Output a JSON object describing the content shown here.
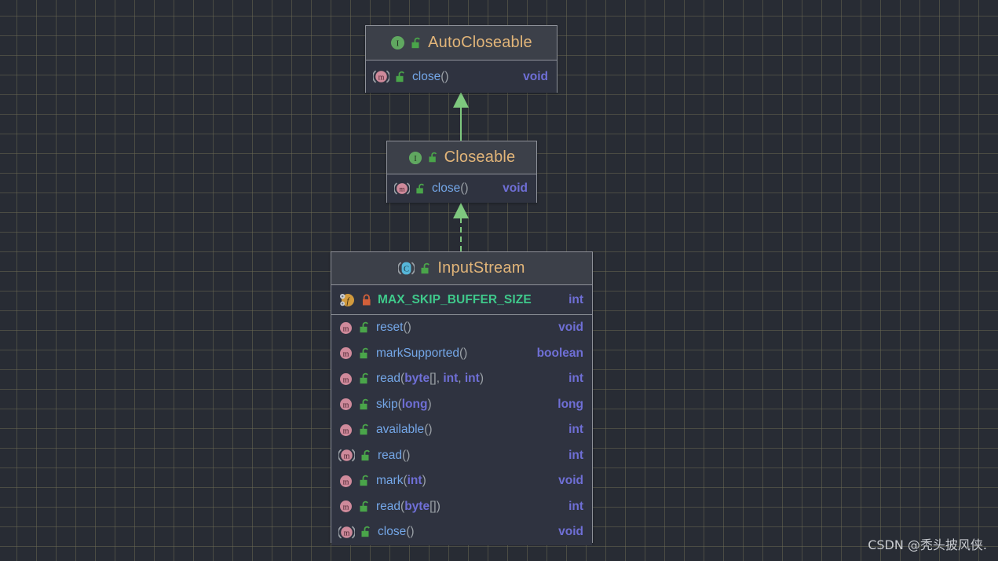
{
  "diagram": {
    "type": "uml-class-diagram",
    "background_color": "#282c34",
    "grid_color": "#6e6c54",
    "box_fill": "#3c4049",
    "body_fill": "#2f3340",
    "border_color": "#8e9199",
    "title_color": "#e2b579",
    "member_name_color": "#74a7e8",
    "return_type_color": "#6f6fd6",
    "constant_color": "#3fc98b",
    "connector_color": "#7ec87e"
  },
  "classes": [
    {
      "id": "auto-closeable",
      "name": "AutoCloseable",
      "stereotype": "interface",
      "kind_icon": "interface-icon",
      "visibility_icon": "unlock-icon",
      "sections": [
        {
          "kind": "methods",
          "members": [
            {
              "icon": "method-abstract-icon",
              "visibility_icon": "unlock-icon",
              "name": "close",
              "params": "",
              "signature": "close()",
              "type": "void"
            }
          ]
        }
      ]
    },
    {
      "id": "closeable",
      "name": "Closeable",
      "stereotype": "interface",
      "kind_icon": "interface-icon",
      "visibility_icon": "unlock-icon",
      "sections": [
        {
          "kind": "methods",
          "members": [
            {
              "icon": "method-abstract-icon",
              "visibility_icon": "unlock-icon",
              "name": "close",
              "params": "",
              "signature": "close()",
              "type": "void"
            }
          ]
        }
      ]
    },
    {
      "id": "input-stream",
      "name": "InputStream",
      "stereotype": "abstract class",
      "kind_icon": "abstract-class-icon",
      "visibility_icon": "unlock-icon",
      "sections": [
        {
          "kind": "fields",
          "members": [
            {
              "icon": "static-field-icon",
              "visibility_icon": "lock-icon",
              "name": "MAX_SKIP_BUFFER_SIZE",
              "signature": "MAX_SKIP_BUFFER_SIZE",
              "type": "int",
              "constant": true
            }
          ]
        },
        {
          "kind": "methods",
          "members": [
            {
              "icon": "method-icon",
              "visibility_icon": "unlock-icon",
              "name": "reset",
              "signature": "reset()",
              "type": "void"
            },
            {
              "icon": "method-icon",
              "visibility_icon": "unlock-icon",
              "name": "markSupported",
              "signature": "markSupported()",
              "type": "boolean"
            },
            {
              "icon": "method-icon",
              "visibility_icon": "unlock-icon",
              "name": "read",
              "signature": "read(byte[], int, int)",
              "type": "int"
            },
            {
              "icon": "method-icon",
              "visibility_icon": "unlock-icon",
              "name": "skip",
              "signature": "skip(long)",
              "type": "long"
            },
            {
              "icon": "method-icon",
              "visibility_icon": "unlock-icon",
              "name": "available",
              "signature": "available()",
              "type": "int"
            },
            {
              "icon": "method-abstract-icon",
              "visibility_icon": "unlock-icon",
              "name": "read",
              "signature": "read()",
              "type": "int"
            },
            {
              "icon": "method-icon",
              "visibility_icon": "unlock-icon",
              "name": "mark",
              "signature": "mark(int)",
              "type": "void"
            },
            {
              "icon": "method-icon",
              "visibility_icon": "unlock-icon",
              "name": "read",
              "signature": "read(byte[])",
              "type": "int"
            },
            {
              "icon": "method-abstract-icon",
              "visibility_icon": "unlock-icon",
              "name": "close",
              "signature": "close()",
              "type": "void"
            }
          ]
        }
      ]
    }
  ],
  "connectors": [
    {
      "id": "closeable-extends-autocloseable",
      "from": "closeable",
      "to": "auto-closeable",
      "style": "solid",
      "arrow": "filled-triangle",
      "relation": "extends"
    },
    {
      "id": "inputstream-implements-closeable",
      "from": "input-stream",
      "to": "closeable",
      "style": "dashed",
      "arrow": "filled-triangle",
      "relation": "implements"
    }
  ],
  "watermark": {
    "text": "CSDN @秃头披风侠."
  }
}
